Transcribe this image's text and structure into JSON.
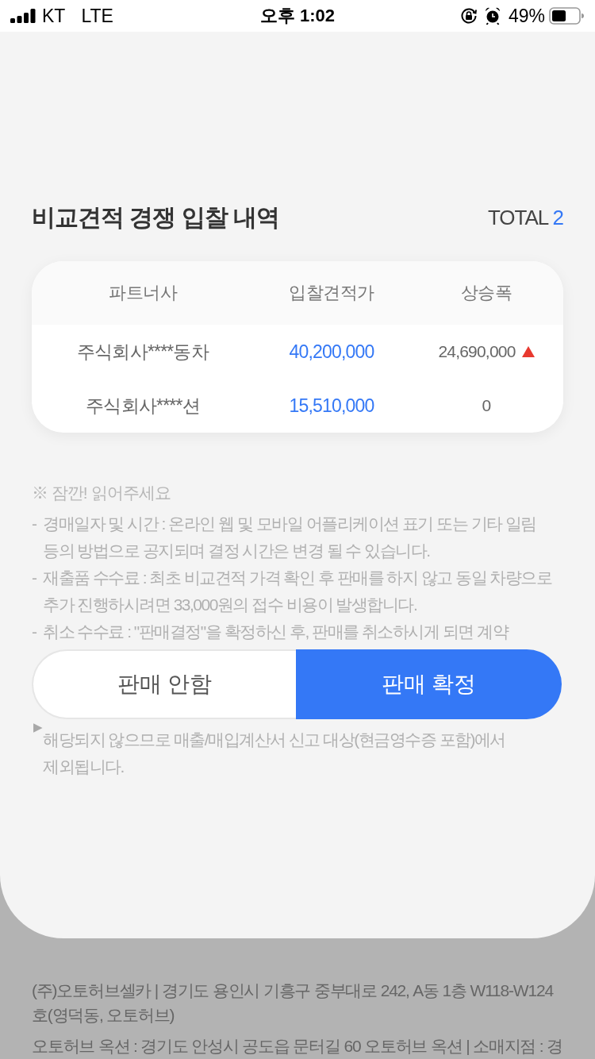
{
  "status_bar": {
    "carrier": "KT",
    "network": "LTE",
    "time": "오후 1:02",
    "battery": "49%"
  },
  "header": {
    "title": "비교견적 경쟁 입찰 내역",
    "total_label": "TOTAL",
    "total_count": "2"
  },
  "table": {
    "columns": [
      "파트너사",
      "입찰견적가",
      "상승폭"
    ],
    "rows": [
      {
        "partner": "주식회사****동차",
        "bid": "40,200,000",
        "increase": "24,690,000",
        "rising": true
      },
      {
        "partner": "주식회사****션",
        "bid": "15,510,000",
        "increase": "0",
        "rising": false
      }
    ]
  },
  "notice": {
    "heading": "※ 잠깐! 읽어주세요",
    "items": [
      {
        "kind": "dash",
        "marker": "-",
        "lines": [
          "경매일자 및 시간 : 온라인 웹 및 모바일 어플리케이션 표기 또는 기타 일림",
          "등의 방법으로 공지되며 결정 시간은 변경 될 수 있습니다."
        ]
      },
      {
        "kind": "dash",
        "marker": "-",
        "lines": [
          "재출품 수수료 : 최초 비교견적 가격 확인 후 판매를 하지 않고 동일 차량으로",
          "추가 진행하시려면 33,000원의 접수 비용이 발생합니다."
        ]
      },
      {
        "kind": "dash",
        "marker": "-",
        "lines": [
          "취소 수수료 : \"판매결정\"을 확정하신 후, 판매를 취소하시게 되면 계약"
        ]
      },
      {
        "kind": "triangle",
        "marker": "▶",
        "lines": [
          "해당되지 않으므로 매출/매입계산서 신고 대상(현금영수증 포함)에서",
          "제외됩니다."
        ]
      }
    ]
  },
  "buttons": [
    {
      "label": "판매 안함",
      "kind": "secondary"
    },
    {
      "label": "판매 확정",
      "kind": "primary"
    }
  ],
  "footer": {
    "paragraphs": [
      {
        "lines": [
          "(주)오토허브셀카 | 경기도 용인시 기흥구 중부대로 242, A동 1층 W118-W124",
          "호(영덕동, 오토허브)"
        ]
      },
      {
        "lines": [
          "오토허브 옥션 : 경기도 안성시 공도읍 문터길 60 오토허브 옥션 | 소매지점 : 경"
        ]
      }
    ]
  }
}
